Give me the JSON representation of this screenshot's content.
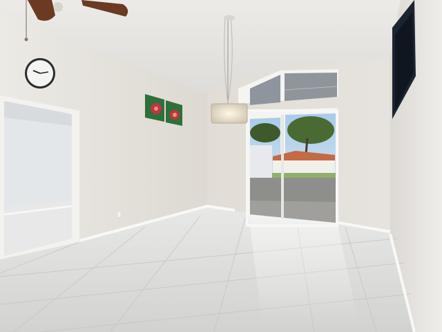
{
  "scene": {
    "description_colors": {
      "ceiling": "#e7e6e3",
      "left_wall": "#e6e3de",
      "back_wall": "#e4e1dc",
      "right_wall": "#e9e7e3",
      "floor": "#dcdcdc",
      "frame": "#f4f4f2",
      "sky": "#b9d6ee",
      "grass": "#8fb06a",
      "patio": "#9a9a96",
      "painting_green": "#2f6f3a",
      "painting_flower": "#c2324a",
      "fan_blade": "#6b3a22",
      "tv_frame": "#1c2431"
    },
    "objects": [
      "ceiling-fan-icon",
      "wall-clock-icon",
      "wall-art-icon",
      "chandelier-icon",
      "sliding-glass-door-icon",
      "transom-window-icon",
      "wall-tv-icon",
      "doorway-icon"
    ]
  }
}
